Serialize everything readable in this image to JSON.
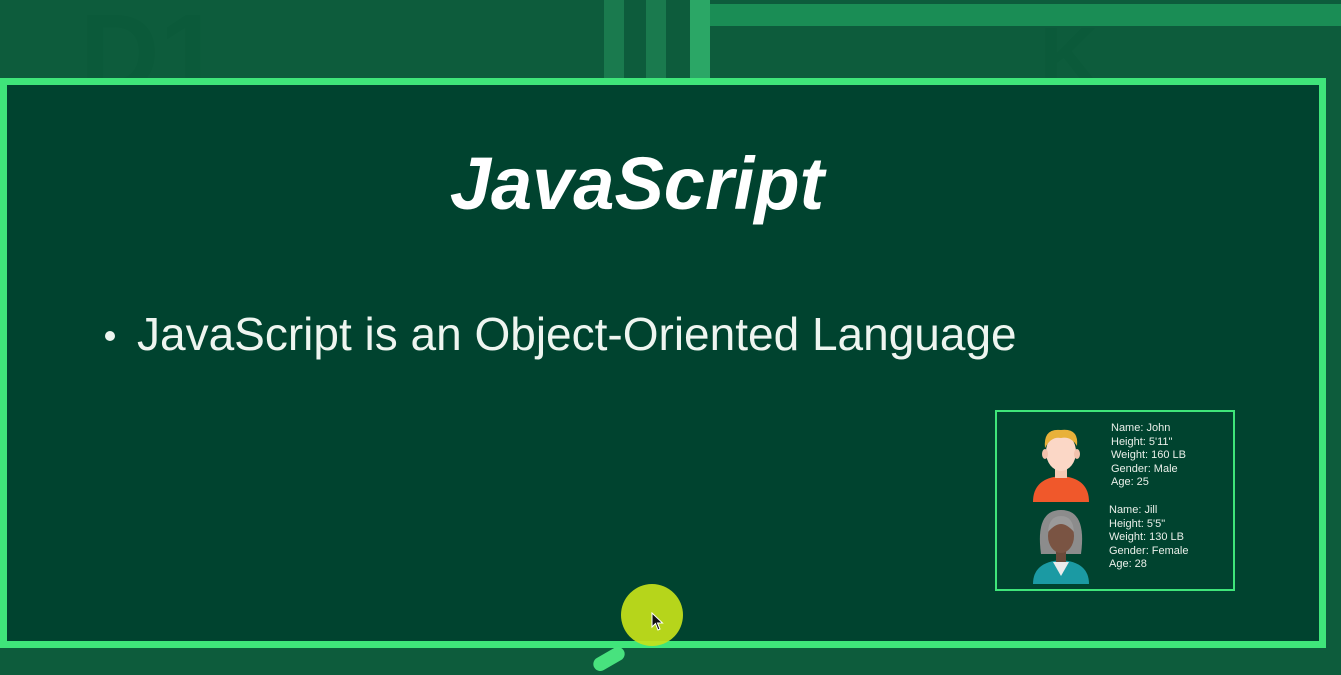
{
  "slide": {
    "title": "JavaScript",
    "bullets": [
      {
        "text": "JavaScript is an Object-Oriented Language"
      }
    ]
  },
  "example_objects": [
    {
      "avatar_icon": "man-avatar-icon",
      "lines": [
        "Name: John",
        "Height: 5'11\"",
        "Weight: 160 LB",
        "Gender: Male",
        "Age: 25"
      ]
    },
    {
      "avatar_icon": "woman-avatar-icon",
      "lines": [
        "Name: Jill",
        "Height: 5'5\"",
        "Weight: 130 LB",
        "Gender: Female",
        "Age: 28"
      ]
    }
  ],
  "colors": {
    "background": "#0d5c3c",
    "slide": "#00432f",
    "accent": "#3fe57a",
    "cursor_highlight": "#c6e21a"
  }
}
